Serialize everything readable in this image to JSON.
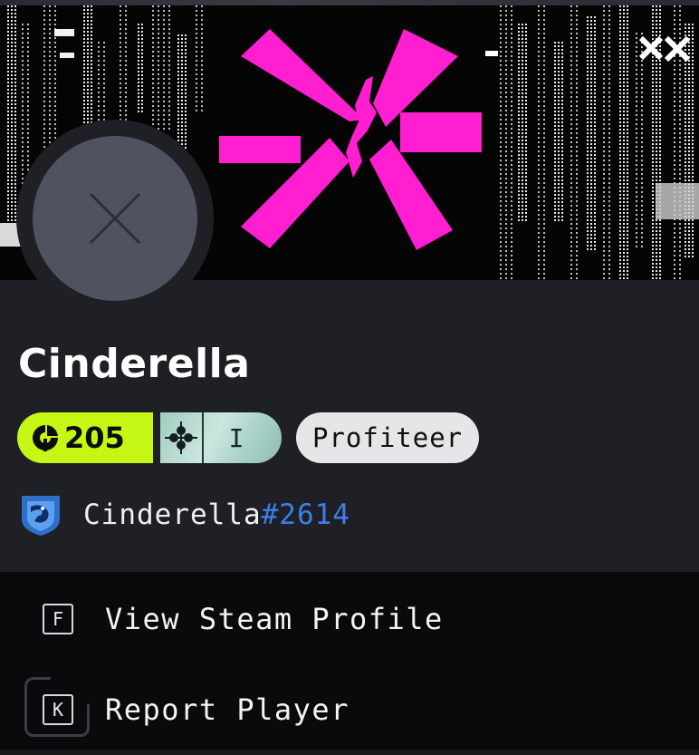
{
  "profile": {
    "name": "Cinderella",
    "level": "205",
    "rank": "I",
    "title": "Profiteer",
    "steam_name": "Cinderella",
    "steam_tag": "#2614"
  },
  "menu": {
    "items": [
      {
        "key": "F",
        "label": "View Steam Profile"
      },
      {
        "key": "K",
        "label": "Report Player"
      }
    ]
  },
  "icons": {
    "avatar": "close-icon",
    "level": "gauge-icon",
    "rank": "rank-emblem-icon",
    "platform": "dragon-shield-icon",
    "banner": "brand-logo"
  },
  "colors": {
    "level_badge": "#c5f614",
    "rank_badge": "#a9d3c8",
    "title_pill": "#e6e6e8",
    "steam_tag": "#3d7ee8",
    "logo": "#ff1ed0",
    "card_bg": "#1f2025",
    "menu_bg": "#0a0a0c"
  }
}
